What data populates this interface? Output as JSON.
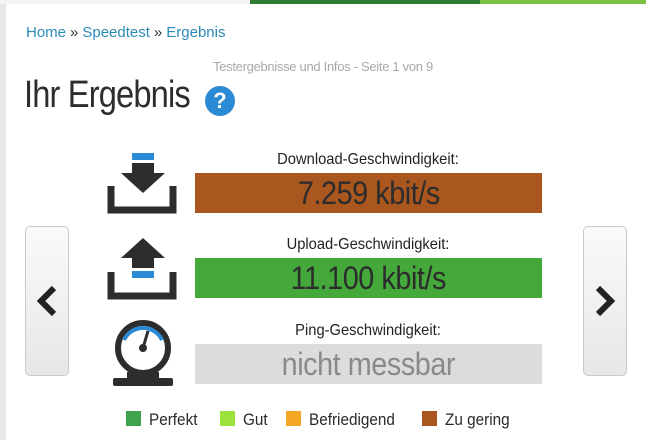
{
  "breadcrumb": {
    "items": [
      "Home",
      "Speedtest",
      "Ergebnis"
    ],
    "separator": "»"
  },
  "header": {
    "subtitle": "Testergebnisse und Infos - Seite 1 von 9",
    "title": "Ihr Ergebnis",
    "help_glyph": "?"
  },
  "metrics": {
    "download": {
      "label": "Download-Geschwindigkeit:",
      "value": "7.259 kbit/s",
      "color": "#a9561f",
      "icon": "download-tray-icon"
    },
    "upload": {
      "label": "Upload-Geschwindigkeit:",
      "value": "11.100 kbit/s",
      "color": "#44a83a",
      "icon": "upload-tray-icon"
    },
    "ping": {
      "label": "Ping-Geschwindigkeit:",
      "value": "nicht messbar",
      "color": "#dcdcdc",
      "icon": "gauge-icon"
    }
  },
  "legend": [
    {
      "label": "Perfekt",
      "color": "#3fa34d"
    },
    {
      "label": "Gut",
      "color": "#9be23a"
    },
    {
      "label": "Befriedigend",
      "color": "#f5a623"
    },
    {
      "label": "Zu gering",
      "color": "#a9561f"
    }
  ],
  "navigation": {
    "prev_icon": "chevron-left-icon",
    "next_icon": "chevron-right-icon"
  }
}
